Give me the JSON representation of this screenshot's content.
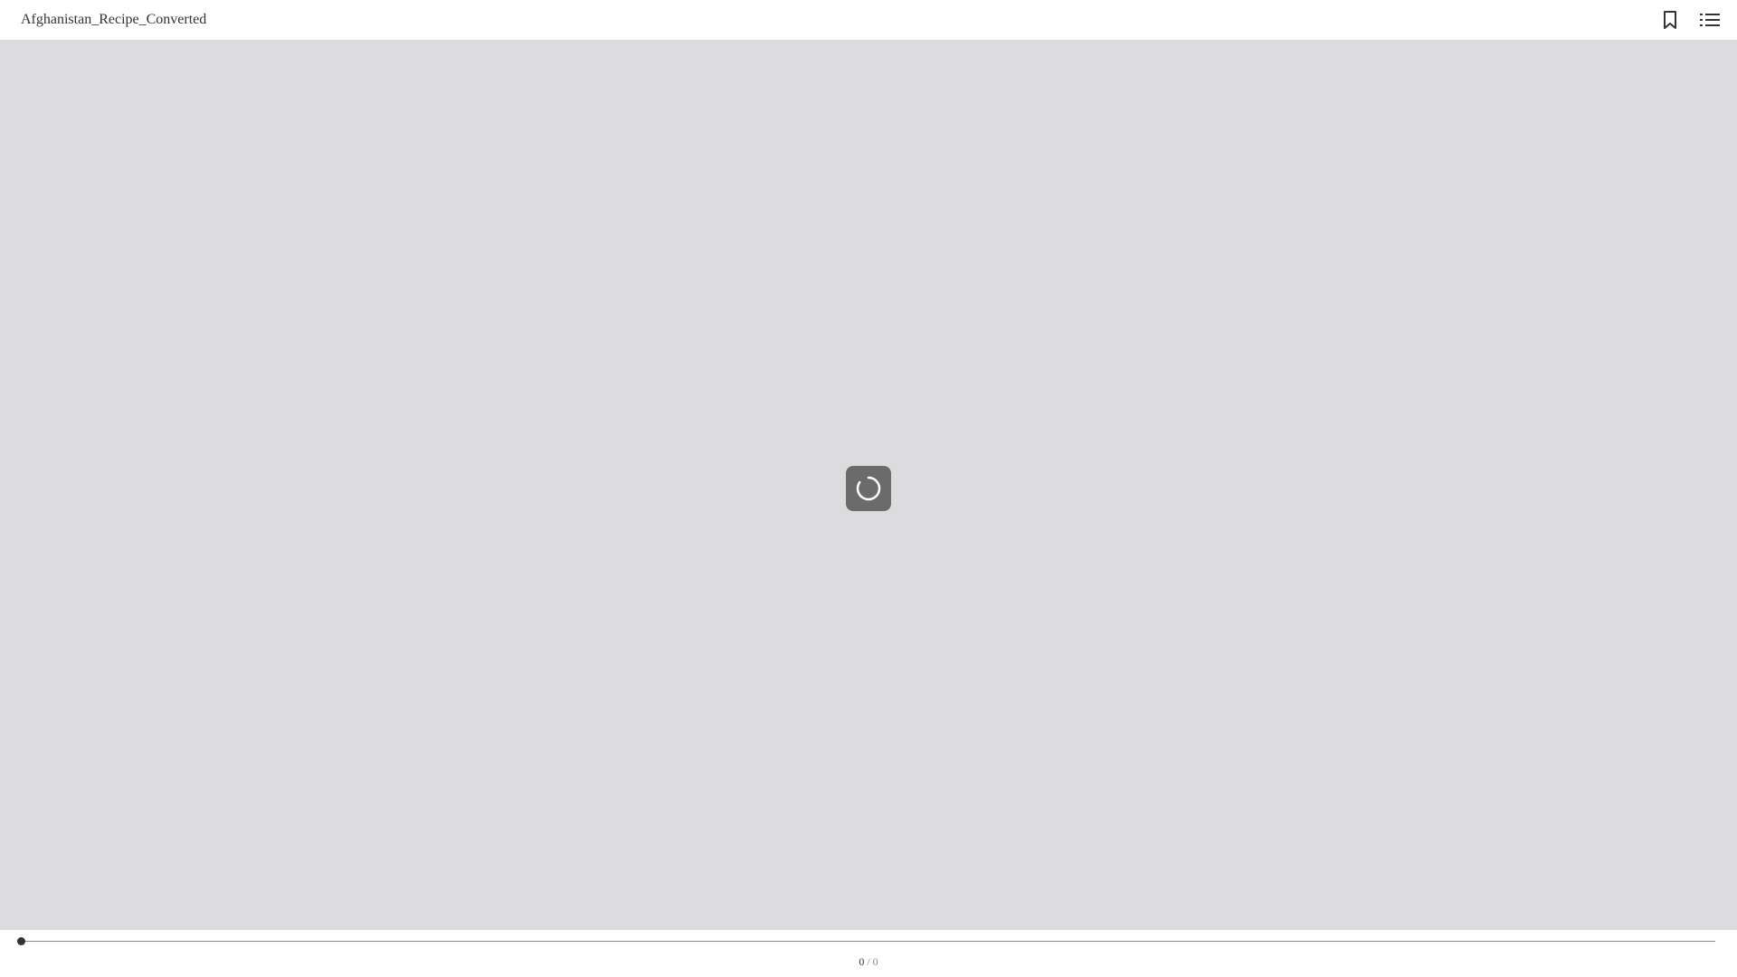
{
  "header": {
    "title": "Afghanistan_Recipe_Converted",
    "bookmark_icon": "bookmark-icon",
    "toc_icon": "list-icon"
  },
  "viewer": {
    "background": "#dcdcde",
    "loading_icon": "spinner-icon"
  },
  "footer": {
    "progress": 0,
    "current_page": "0",
    "separator": "/",
    "total_pages": "0"
  }
}
